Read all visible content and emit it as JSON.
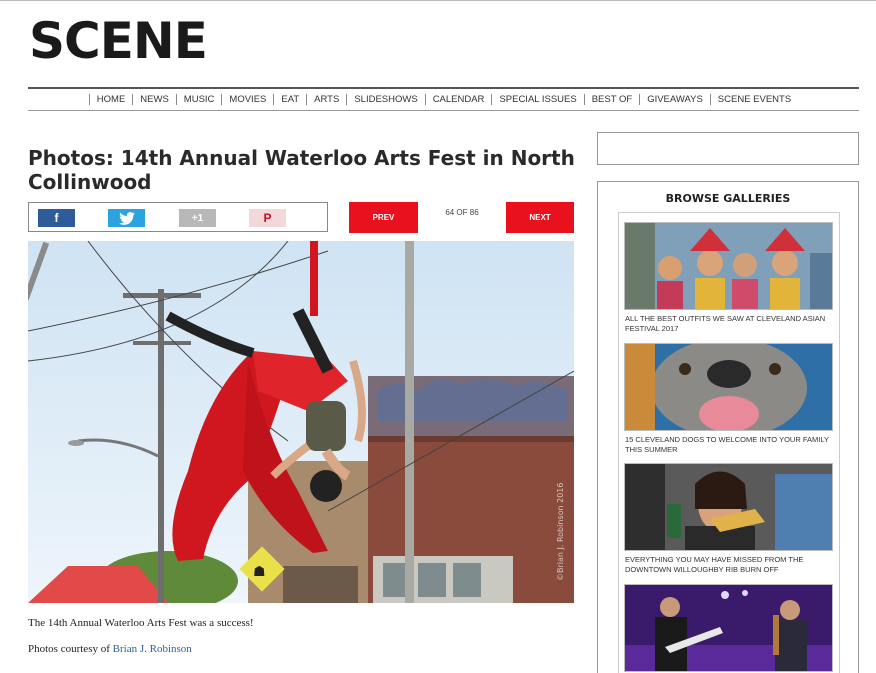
{
  "site": {
    "logo": "SCENE"
  },
  "nav": [
    "HOME",
    "NEWS",
    "MUSIC",
    "MOVIES",
    "EAT",
    "ARTS",
    "SLIDESHOWS",
    "CALENDAR",
    "SPECIAL ISSUES",
    "BEST OF",
    "GIVEAWAYS",
    "SCENE EVENTS"
  ],
  "article": {
    "title": "Photos: 14th Annual Waterloo Arts Fest in North Collinwood",
    "caption": "The 14th Annual Waterloo Arts Fest was a success!",
    "credit_prefix": "Photos courtesy of ",
    "credit_name": "Brian J. Robinson",
    "photo_watermark": "©Brian J. Robinson 2016"
  },
  "share": {
    "facebook": "f",
    "twitter": "twitter-bird-icon",
    "googleplus": "+1",
    "pinterest": "P"
  },
  "pager": {
    "prev": "PREV",
    "next": "NEXT",
    "counter": "64 OF 86"
  },
  "sidebar": {
    "title": "BROWSE GALLERIES",
    "galleries": [
      {
        "label": "ALL THE BEST OUTFITS WE SAW AT CLEVELAND ASIAN FESTIVAL 2017"
      },
      {
        "label": "15 CLEVELAND DOGS TO WELCOME INTO YOUR FAMILY THIS SUMMER"
      },
      {
        "label": "EVERYTHING YOU MAY HAVE MISSED FROM THE DOWNTOWN WILLOUGHBY RIB BURN OFF"
      },
      {
        "label": ""
      }
    ]
  },
  "colors": {
    "accent_red": "#e8111d",
    "facebook": "#2e5b9a",
    "twitter": "#2aa3de",
    "link": "#2f5f9c"
  }
}
